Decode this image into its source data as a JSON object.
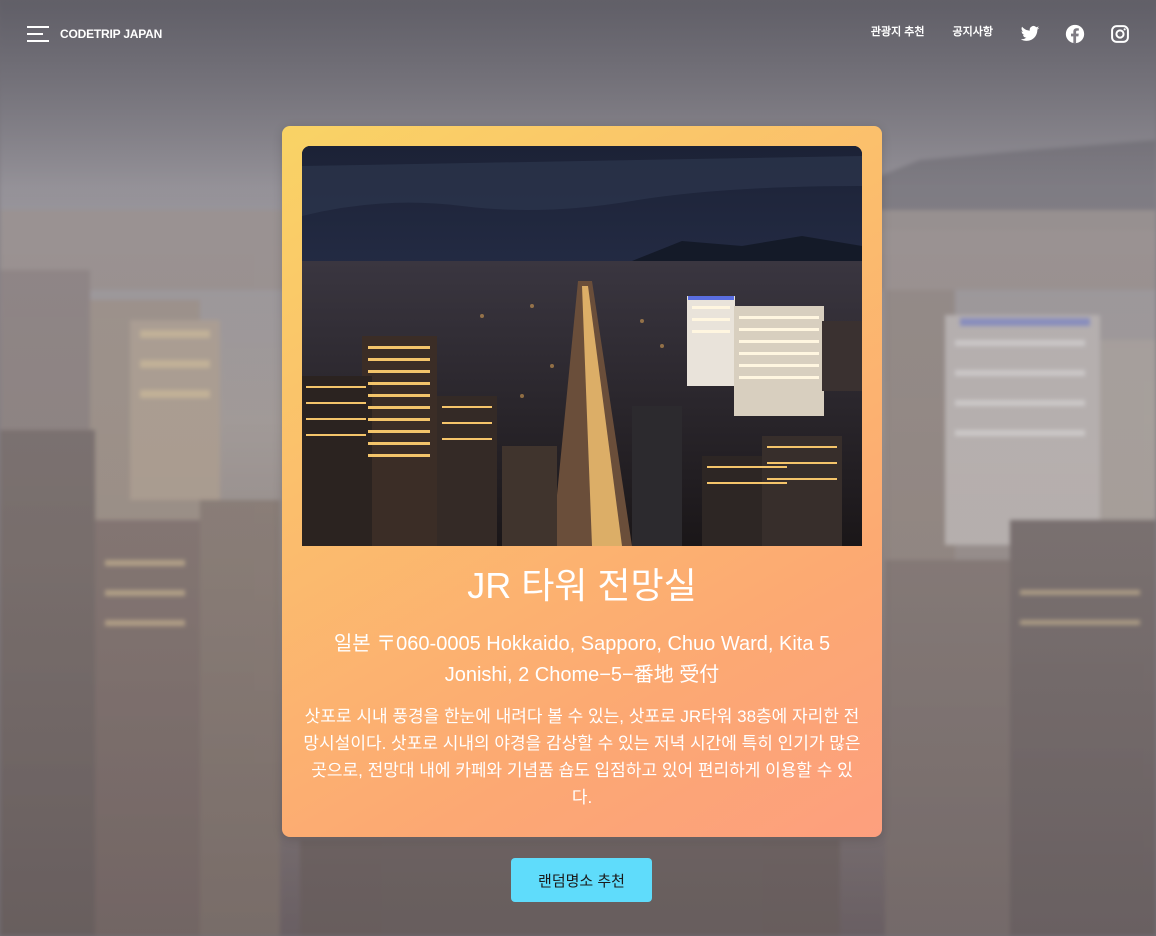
{
  "header": {
    "logo": "CODETRIP JAPAN",
    "nav": [
      {
        "label": "관광지 추천"
      },
      {
        "label": "공지사항"
      }
    ],
    "social": [
      "twitter-icon",
      "facebook-icon",
      "instagram-icon"
    ]
  },
  "place": {
    "title": "JR 타워 전망실",
    "address": "일본 〒060-0005 Hokkaido, Sapporo, Chuo Ward, Kita 5 Jonishi, 2 Chome−5−番地 受付",
    "description": "삿포로 시내 풍경을 한눈에 내려다 볼 수 있는, 삿포로 JR타워 38층에 자리한 전망시설이다. 삿포로 시내의 야경을 감상할 수 있는 저녁 시간에 특히 인기가 많은 곳으로, 전망대 내에 카페와 기념품 숍도 입점하고 있어 편리하게 이용할 수 있다."
  },
  "actions": {
    "random_label": "랜덤명소 추천"
  },
  "colors": {
    "card_gradient_start": "#f9d365",
    "card_gradient_end": "#fd9f7e",
    "button": "#5fdcfb"
  }
}
